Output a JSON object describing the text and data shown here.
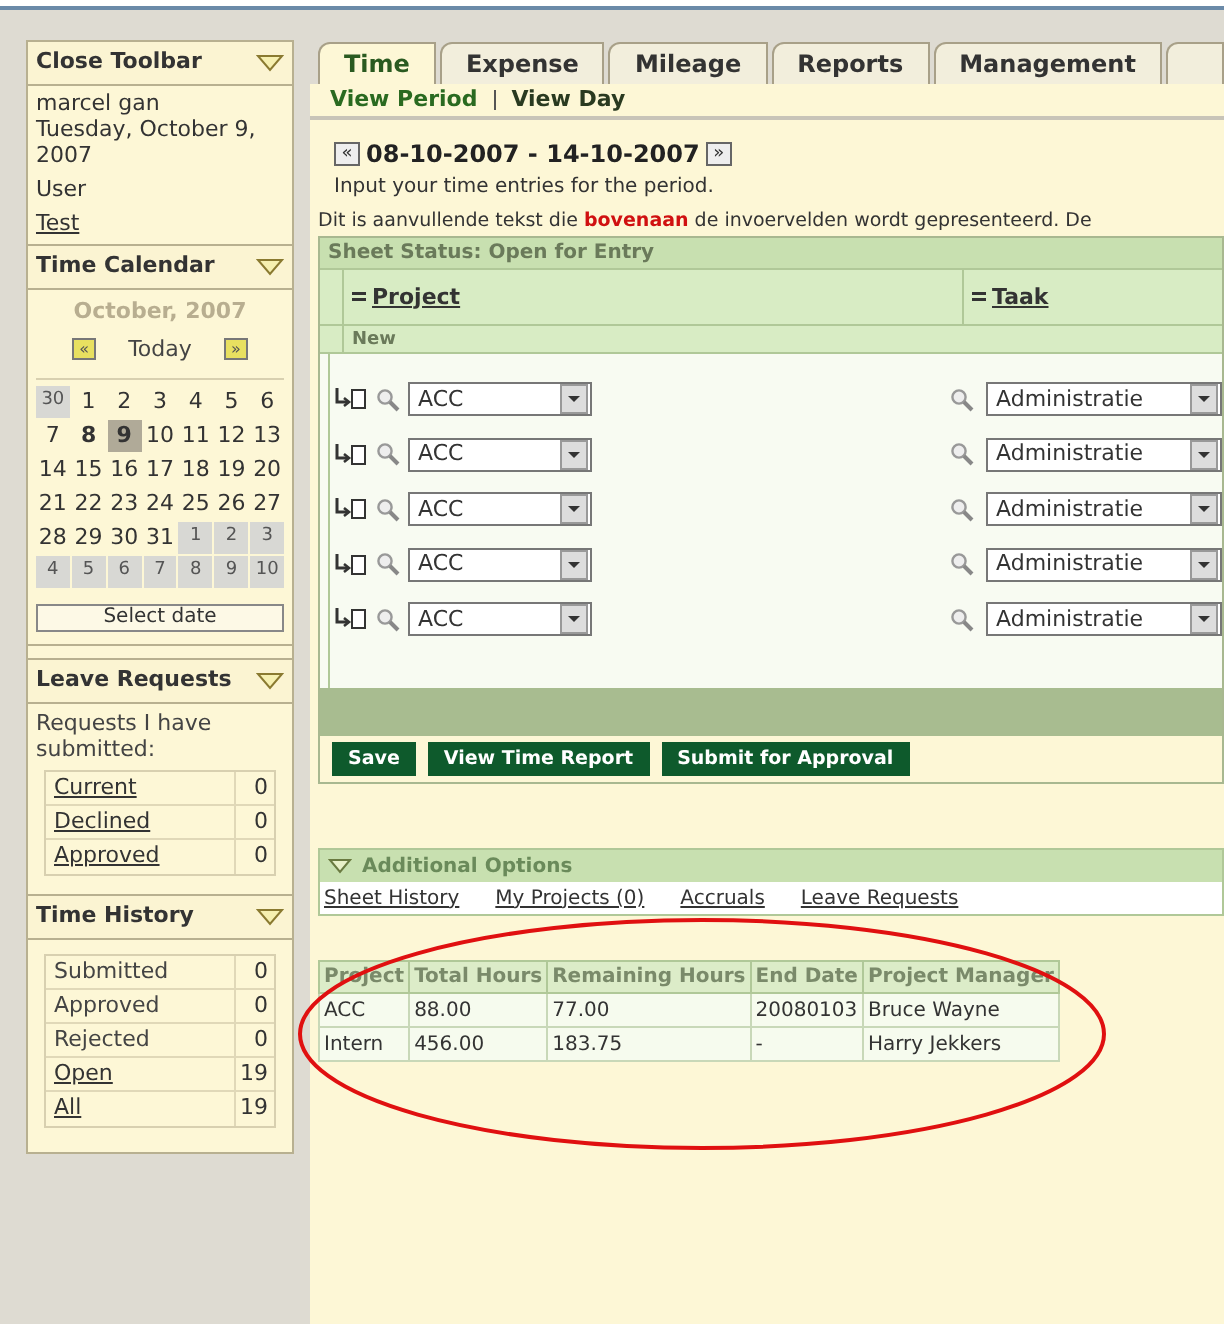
{
  "sidebar": {
    "toolbar": {
      "title": "Close Toolbar",
      "lines": [
        "marcel gan",
        "Tuesday, October 9, 2007",
        "User"
      ],
      "link": "Test"
    },
    "calendar": {
      "title": "Time Calendar",
      "month": "October, 2007",
      "today": "Today",
      "button": "Select date",
      "prev": "«",
      "next": "»",
      "days": [
        {
          "d": "30",
          "kind": "other",
          "selected": false,
          "bold": false
        },
        {
          "d": "1",
          "kind": "current",
          "selected": false,
          "bold": false
        },
        {
          "d": "2",
          "kind": "current",
          "selected": false,
          "bold": false
        },
        {
          "d": "3",
          "kind": "current",
          "selected": false,
          "bold": false
        },
        {
          "d": "4",
          "kind": "current",
          "selected": false,
          "bold": false
        },
        {
          "d": "5",
          "kind": "current",
          "selected": false,
          "bold": false
        },
        {
          "d": "6",
          "kind": "current",
          "selected": false,
          "bold": false
        },
        {
          "d": "7",
          "kind": "current",
          "selected": false,
          "bold": false
        },
        {
          "d": "8",
          "kind": "current",
          "selected": false,
          "bold": true
        },
        {
          "d": "9",
          "kind": "current",
          "selected": true,
          "bold": true
        },
        {
          "d": "10",
          "kind": "current",
          "selected": false,
          "bold": false
        },
        {
          "d": "11",
          "kind": "current",
          "selected": false,
          "bold": false
        },
        {
          "d": "12",
          "kind": "current",
          "selected": false,
          "bold": false
        },
        {
          "d": "13",
          "kind": "current",
          "selected": false,
          "bold": false
        },
        {
          "d": "14",
          "kind": "current",
          "selected": false,
          "bold": false
        },
        {
          "d": "15",
          "kind": "current",
          "selected": false,
          "bold": false
        },
        {
          "d": "16",
          "kind": "current",
          "selected": false,
          "bold": false
        },
        {
          "d": "17",
          "kind": "current",
          "selected": false,
          "bold": false
        },
        {
          "d": "18",
          "kind": "current",
          "selected": false,
          "bold": false
        },
        {
          "d": "19",
          "kind": "current",
          "selected": false,
          "bold": false
        },
        {
          "d": "20",
          "kind": "current",
          "selected": false,
          "bold": false
        },
        {
          "d": "21",
          "kind": "current",
          "selected": false,
          "bold": false
        },
        {
          "d": "22",
          "kind": "current",
          "selected": false,
          "bold": false
        },
        {
          "d": "23",
          "kind": "current",
          "selected": false,
          "bold": false
        },
        {
          "d": "24",
          "kind": "current",
          "selected": false,
          "bold": false
        },
        {
          "d": "25",
          "kind": "current",
          "selected": false,
          "bold": false
        },
        {
          "d": "26",
          "kind": "current",
          "selected": false,
          "bold": false
        },
        {
          "d": "27",
          "kind": "current",
          "selected": false,
          "bold": false
        },
        {
          "d": "28",
          "kind": "current",
          "selected": false,
          "bold": false
        },
        {
          "d": "29",
          "kind": "current",
          "selected": false,
          "bold": false
        },
        {
          "d": "30",
          "kind": "current",
          "selected": false,
          "bold": false
        },
        {
          "d": "31",
          "kind": "current",
          "selected": false,
          "bold": false
        },
        {
          "d": "1",
          "kind": "other",
          "selected": false,
          "bold": false
        },
        {
          "d": "2",
          "kind": "other",
          "selected": false,
          "bold": false
        },
        {
          "d": "3",
          "kind": "other",
          "selected": false,
          "bold": false
        },
        {
          "d": "4",
          "kind": "other",
          "selected": false,
          "bold": false
        },
        {
          "d": "5",
          "kind": "other",
          "selected": false,
          "bold": false
        },
        {
          "d": "6",
          "kind": "other",
          "selected": false,
          "bold": false
        },
        {
          "d": "7",
          "kind": "other",
          "selected": false,
          "bold": false
        },
        {
          "d": "8",
          "kind": "other",
          "selected": false,
          "bold": false
        },
        {
          "d": "9",
          "kind": "other",
          "selected": false,
          "bold": false
        },
        {
          "d": "10",
          "kind": "other",
          "selected": false,
          "bold": false
        }
      ]
    },
    "leave": {
      "title": "Leave Requests",
      "intro": "Requests I have submitted:",
      "rows": [
        {
          "label": "Current",
          "count": "0",
          "link": true
        },
        {
          "label": "Declined",
          "count": "0",
          "link": true
        },
        {
          "label": "Approved",
          "count": "0",
          "link": true
        }
      ]
    },
    "history": {
      "title": "Time History",
      "rows": [
        {
          "label": "Submitted",
          "count": "0",
          "link": false
        },
        {
          "label": "Approved",
          "count": "0",
          "link": false
        },
        {
          "label": "Rejected",
          "count": "0",
          "link": false
        },
        {
          "label": "Open",
          "count": "19",
          "link": true
        },
        {
          "label": "All",
          "count": "19",
          "link": true
        }
      ]
    }
  },
  "tabs": [
    {
      "label": "Time",
      "selected": true
    },
    {
      "label": "Expense",
      "selected": false
    },
    {
      "label": "Mileage",
      "selected": false
    },
    {
      "label": "Reports",
      "selected": false
    },
    {
      "label": "Management",
      "selected": false
    }
  ],
  "subnav": [
    "View Period",
    "View Day"
  ],
  "period": {
    "prev": "«",
    "range": "08-10-2007 - 14-10-2007",
    "next": "»",
    "hint": "Input your time entries for the period.",
    "note": "Dit is aanvullende tekst die **bovenaan** de invoervelden wordt gepresenteerd. De"
  },
  "sheet": {
    "status": "Sheet Status: Open for Entry",
    "columns": [
      "Project",
      "Taak"
    ],
    "group": "New",
    "rows": [
      {
        "project": "ACC",
        "task": "Administratie"
      },
      {
        "project": "ACC",
        "task": "Administratie"
      },
      {
        "project": "ACC",
        "task": "Administratie"
      },
      {
        "project": "ACC",
        "task": "Administratie"
      },
      {
        "project": "ACC",
        "task": "Administratie"
      }
    ]
  },
  "buttons": [
    "Save",
    "View Time Report",
    "Submit for Approval"
  ],
  "options": {
    "title": "Additional Options",
    "links": [
      "Sheet History",
      "My Projects (0)",
      "Accruals",
      "Leave Requests"
    ]
  },
  "projects": {
    "columns": [
      "Project",
      "Total Hours",
      "Remaining Hours",
      "End Date",
      "Project Manager"
    ],
    "rows": [
      [
        "ACC",
        "88.00",
        "77.00",
        "20080103",
        "Bruce Wayne"
      ],
      [
        "Intern",
        "456.00",
        "183.75",
        "-",
        "Harry Jekkers"
      ]
    ]
  }
}
